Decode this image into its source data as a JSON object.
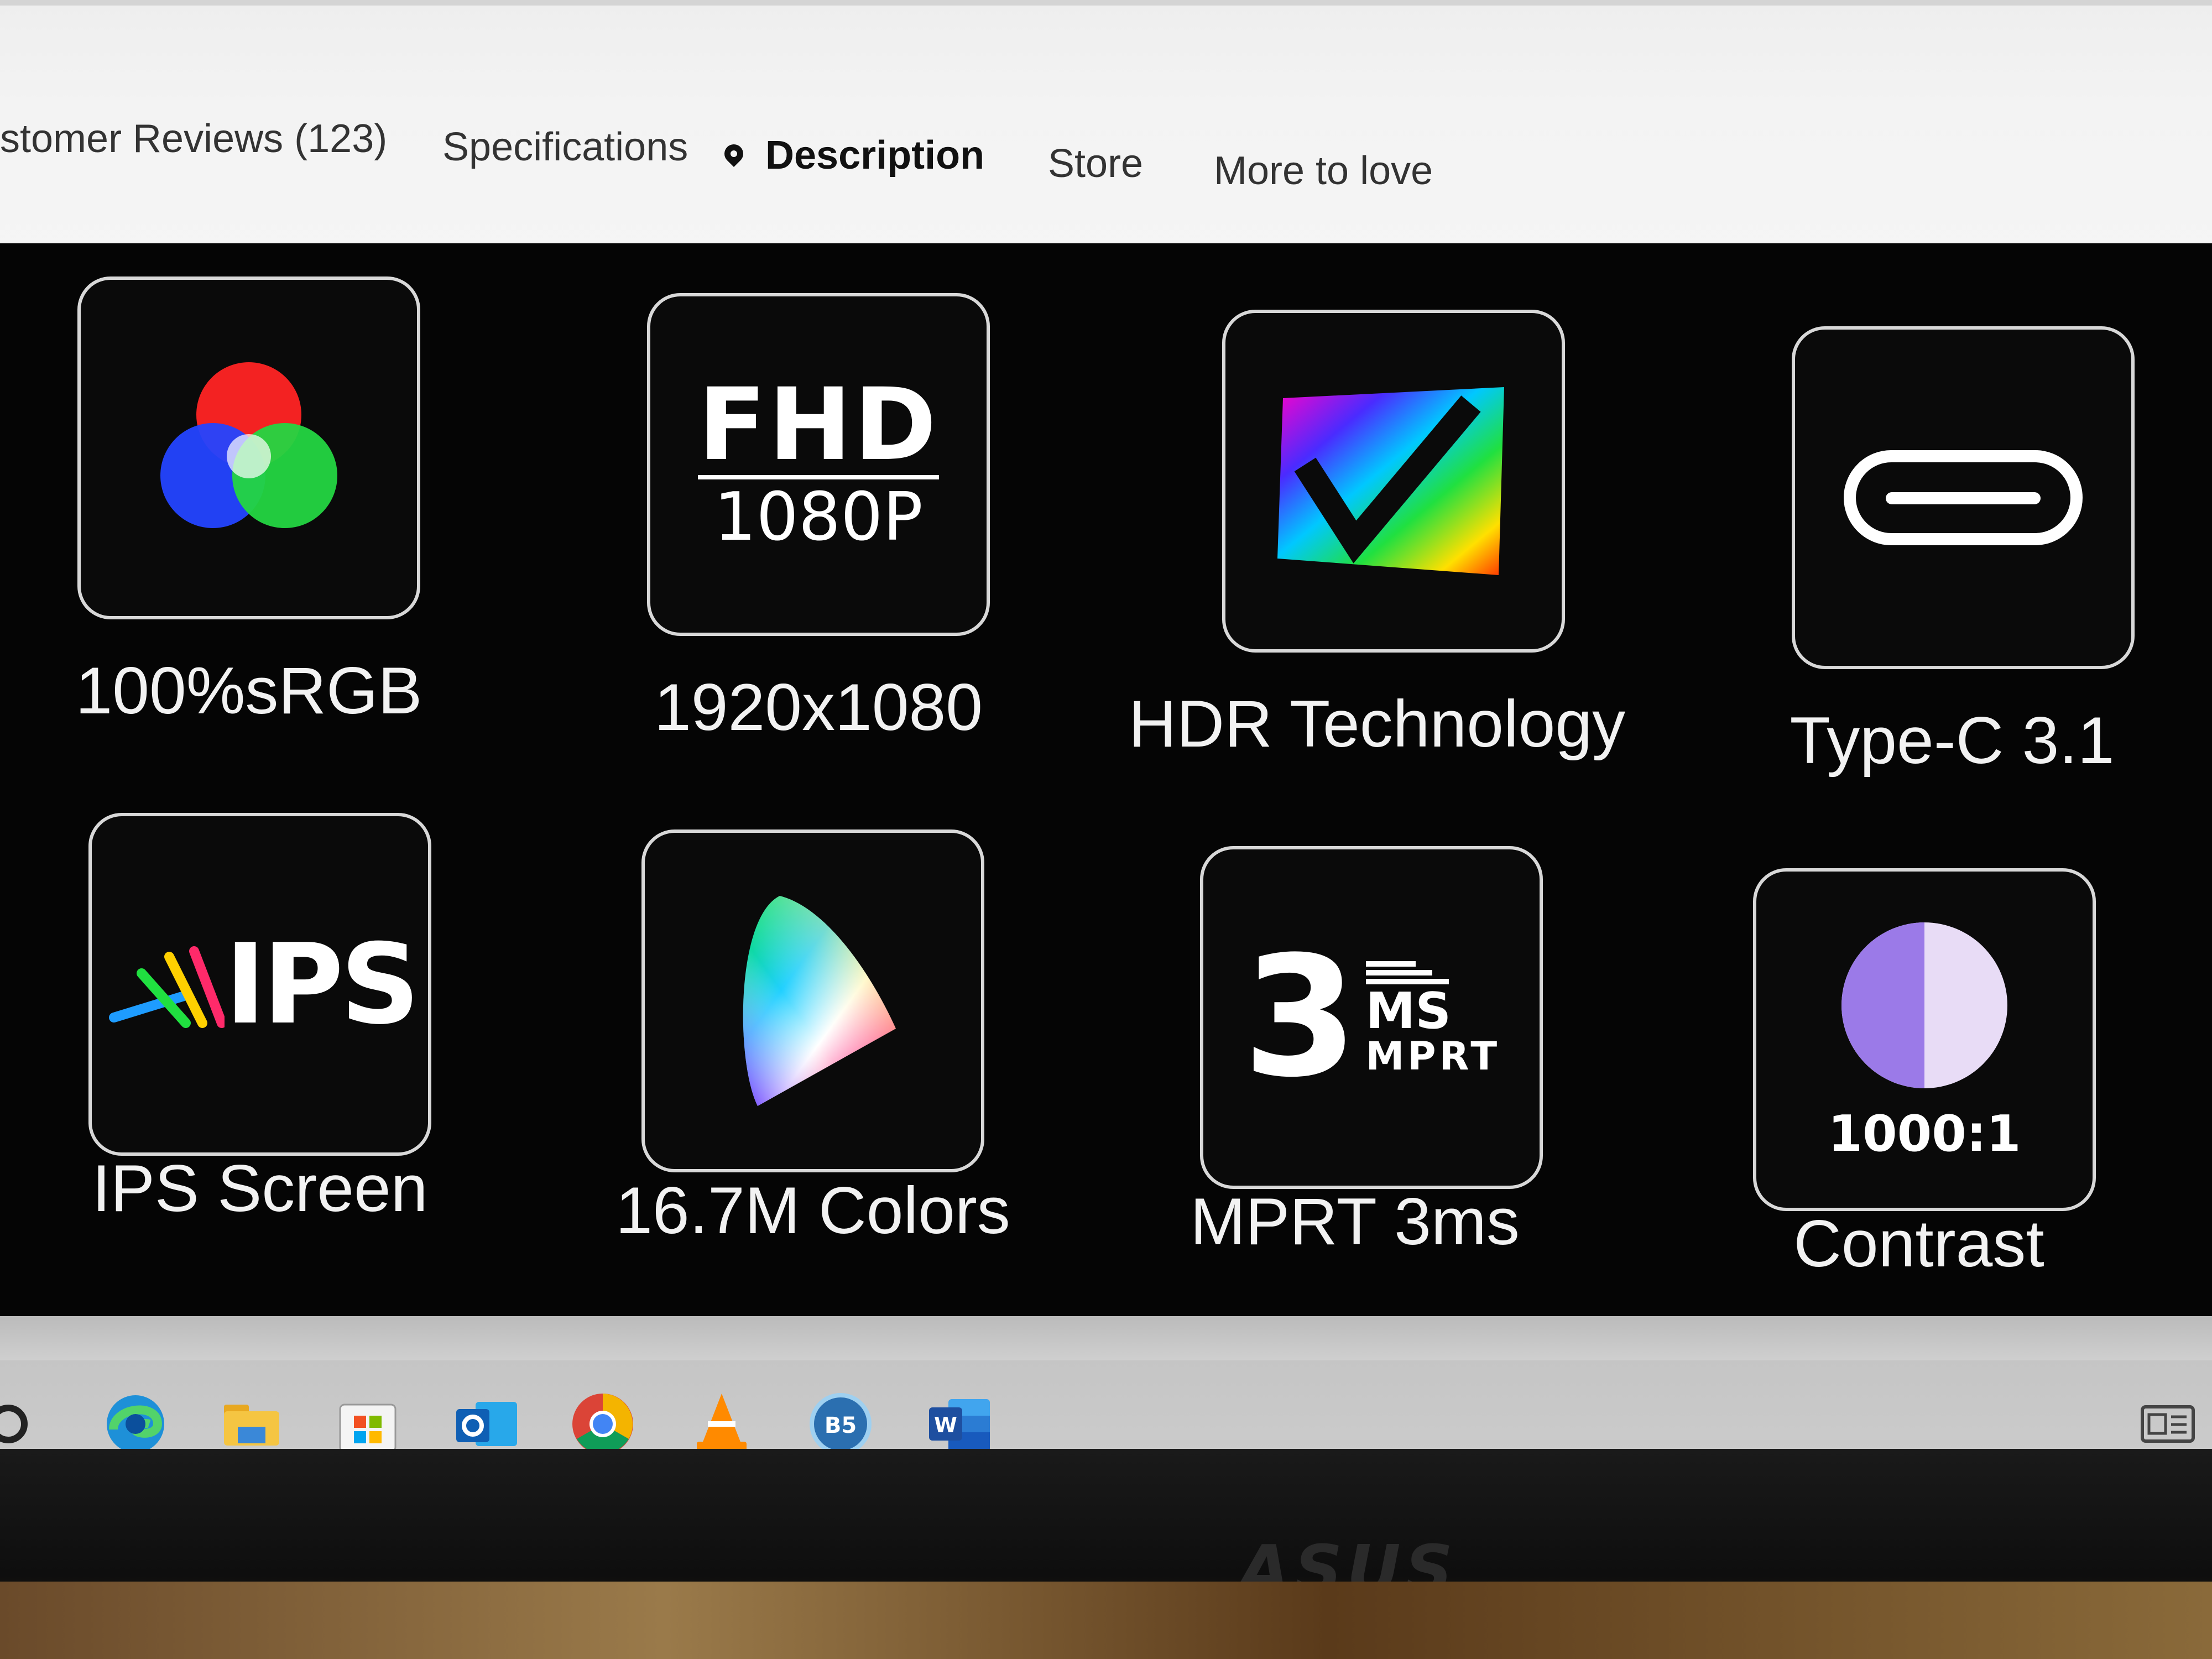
{
  "nav": {
    "tabs": [
      {
        "label": "stomer Reviews (123)"
      },
      {
        "label": "Specifications"
      },
      {
        "label": "Description",
        "active": true,
        "icon": "location-pin-icon"
      },
      {
        "label": "Store"
      },
      {
        "label": "More to love"
      }
    ]
  },
  "features": [
    {
      "label": "100%sRGB",
      "icon": "rgb-circles-icon"
    },
    {
      "label": "1920x1080",
      "icon": "fhd-icon",
      "icon_text_main": "FHD",
      "icon_text_sub": "1080P"
    },
    {
      "label": "HDR Technology",
      "icon": "hdr-check-icon"
    },
    {
      "label": "Type-C 3.1",
      "icon": "usb-c-port-icon"
    },
    {
      "label": "IPS Screen",
      "icon": "ips-icon",
      "icon_text": "IPS"
    },
    {
      "label": "16.7M Colors",
      "icon": "color-gamut-icon"
    },
    {
      "label": "MPRT 3ms",
      "icon": "mprt-icon",
      "icon_text_num": "3",
      "icon_text_ms": "MS",
      "icon_text_mprt": "MPRT"
    },
    {
      "label": "Contrast",
      "icon": "contrast-pie-icon",
      "icon_text": "1000:1"
    }
  ],
  "taskbar": {
    "items": [
      {
        "name": "search-icon"
      },
      {
        "name": "edge-icon"
      },
      {
        "name": "file-explorer-icon"
      },
      {
        "name": "microsoft-store-icon"
      },
      {
        "name": "outlook-icon"
      },
      {
        "name": "chrome-icon"
      },
      {
        "name": "vlc-icon"
      },
      {
        "name": "media-app-icon",
        "text": "B5"
      },
      {
        "name": "word-icon",
        "text": "W",
        "active": true
      }
    ]
  },
  "monitor": {
    "brand": "ASUS"
  },
  "colors": {
    "panel_bg": "#050505",
    "card_border": "#d8d8d8",
    "nav_bg": "#f3f3f3",
    "taskbar_bg": "#c8c8c8",
    "active_indicator": "#2a7fcf"
  }
}
